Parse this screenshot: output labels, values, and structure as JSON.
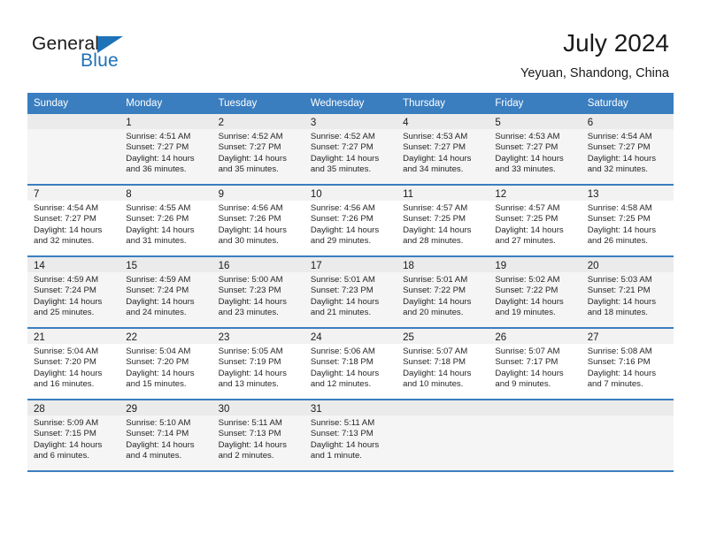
{
  "brand": {
    "name_part1": "General",
    "name_part2": "Blue",
    "accent_color": "#1d72b8"
  },
  "header": {
    "title": "July 2024",
    "subtitle": "Yeyuan, Shandong, China"
  },
  "theme": {
    "header_row_bg": "#3a7ec0",
    "daynum_bg": "#f2f2f2",
    "alt_row_bg": "#f5f5f5"
  },
  "weekday_headers": [
    "Sunday",
    "Monday",
    "Tuesday",
    "Wednesday",
    "Thursday",
    "Friday",
    "Saturday"
  ],
  "weeks": [
    [
      {
        "day": "",
        "sunrise": "",
        "sunset": "",
        "daylight_line1": "",
        "daylight_line2": ""
      },
      {
        "day": "1",
        "sunrise": "Sunrise: 4:51 AM",
        "sunset": "Sunset: 7:27 PM",
        "daylight_line1": "Daylight: 14 hours",
        "daylight_line2": "and 36 minutes."
      },
      {
        "day": "2",
        "sunrise": "Sunrise: 4:52 AM",
        "sunset": "Sunset: 7:27 PM",
        "daylight_line1": "Daylight: 14 hours",
        "daylight_line2": "and 35 minutes."
      },
      {
        "day": "3",
        "sunrise": "Sunrise: 4:52 AM",
        "sunset": "Sunset: 7:27 PM",
        "daylight_line1": "Daylight: 14 hours",
        "daylight_line2": "and 35 minutes."
      },
      {
        "day": "4",
        "sunrise": "Sunrise: 4:53 AM",
        "sunset": "Sunset: 7:27 PM",
        "daylight_line1": "Daylight: 14 hours",
        "daylight_line2": "and 34 minutes."
      },
      {
        "day": "5",
        "sunrise": "Sunrise: 4:53 AM",
        "sunset": "Sunset: 7:27 PM",
        "daylight_line1": "Daylight: 14 hours",
        "daylight_line2": "and 33 minutes."
      },
      {
        "day": "6",
        "sunrise": "Sunrise: 4:54 AM",
        "sunset": "Sunset: 7:27 PM",
        "daylight_line1": "Daylight: 14 hours",
        "daylight_line2": "and 32 minutes."
      }
    ],
    [
      {
        "day": "7",
        "sunrise": "Sunrise: 4:54 AM",
        "sunset": "Sunset: 7:27 PM",
        "daylight_line1": "Daylight: 14 hours",
        "daylight_line2": "and 32 minutes."
      },
      {
        "day": "8",
        "sunrise": "Sunrise: 4:55 AM",
        "sunset": "Sunset: 7:26 PM",
        "daylight_line1": "Daylight: 14 hours",
        "daylight_line2": "and 31 minutes."
      },
      {
        "day": "9",
        "sunrise": "Sunrise: 4:56 AM",
        "sunset": "Sunset: 7:26 PM",
        "daylight_line1": "Daylight: 14 hours",
        "daylight_line2": "and 30 minutes."
      },
      {
        "day": "10",
        "sunrise": "Sunrise: 4:56 AM",
        "sunset": "Sunset: 7:26 PM",
        "daylight_line1": "Daylight: 14 hours",
        "daylight_line2": "and 29 minutes."
      },
      {
        "day": "11",
        "sunrise": "Sunrise: 4:57 AM",
        "sunset": "Sunset: 7:25 PM",
        "daylight_line1": "Daylight: 14 hours",
        "daylight_line2": "and 28 minutes."
      },
      {
        "day": "12",
        "sunrise": "Sunrise: 4:57 AM",
        "sunset": "Sunset: 7:25 PM",
        "daylight_line1": "Daylight: 14 hours",
        "daylight_line2": "and 27 minutes."
      },
      {
        "day": "13",
        "sunrise": "Sunrise: 4:58 AM",
        "sunset": "Sunset: 7:25 PM",
        "daylight_line1": "Daylight: 14 hours",
        "daylight_line2": "and 26 minutes."
      }
    ],
    [
      {
        "day": "14",
        "sunrise": "Sunrise: 4:59 AM",
        "sunset": "Sunset: 7:24 PM",
        "daylight_line1": "Daylight: 14 hours",
        "daylight_line2": "and 25 minutes."
      },
      {
        "day": "15",
        "sunrise": "Sunrise: 4:59 AM",
        "sunset": "Sunset: 7:24 PM",
        "daylight_line1": "Daylight: 14 hours",
        "daylight_line2": "and 24 minutes."
      },
      {
        "day": "16",
        "sunrise": "Sunrise: 5:00 AM",
        "sunset": "Sunset: 7:23 PM",
        "daylight_line1": "Daylight: 14 hours",
        "daylight_line2": "and 23 minutes."
      },
      {
        "day": "17",
        "sunrise": "Sunrise: 5:01 AM",
        "sunset": "Sunset: 7:23 PM",
        "daylight_line1": "Daylight: 14 hours",
        "daylight_line2": "and 21 minutes."
      },
      {
        "day": "18",
        "sunrise": "Sunrise: 5:01 AM",
        "sunset": "Sunset: 7:22 PM",
        "daylight_line1": "Daylight: 14 hours",
        "daylight_line2": "and 20 minutes."
      },
      {
        "day": "19",
        "sunrise": "Sunrise: 5:02 AM",
        "sunset": "Sunset: 7:22 PM",
        "daylight_line1": "Daylight: 14 hours",
        "daylight_line2": "and 19 minutes."
      },
      {
        "day": "20",
        "sunrise": "Sunrise: 5:03 AM",
        "sunset": "Sunset: 7:21 PM",
        "daylight_line1": "Daylight: 14 hours",
        "daylight_line2": "and 18 minutes."
      }
    ],
    [
      {
        "day": "21",
        "sunrise": "Sunrise: 5:04 AM",
        "sunset": "Sunset: 7:20 PM",
        "daylight_line1": "Daylight: 14 hours",
        "daylight_line2": "and 16 minutes."
      },
      {
        "day": "22",
        "sunrise": "Sunrise: 5:04 AM",
        "sunset": "Sunset: 7:20 PM",
        "daylight_line1": "Daylight: 14 hours",
        "daylight_line2": "and 15 minutes."
      },
      {
        "day": "23",
        "sunrise": "Sunrise: 5:05 AM",
        "sunset": "Sunset: 7:19 PM",
        "daylight_line1": "Daylight: 14 hours",
        "daylight_line2": "and 13 minutes."
      },
      {
        "day": "24",
        "sunrise": "Sunrise: 5:06 AM",
        "sunset": "Sunset: 7:18 PM",
        "daylight_line1": "Daylight: 14 hours",
        "daylight_line2": "and 12 minutes."
      },
      {
        "day": "25",
        "sunrise": "Sunrise: 5:07 AM",
        "sunset": "Sunset: 7:18 PM",
        "daylight_line1": "Daylight: 14 hours",
        "daylight_line2": "and 10 minutes."
      },
      {
        "day": "26",
        "sunrise": "Sunrise: 5:07 AM",
        "sunset": "Sunset: 7:17 PM",
        "daylight_line1": "Daylight: 14 hours",
        "daylight_line2": "and 9 minutes."
      },
      {
        "day": "27",
        "sunrise": "Sunrise: 5:08 AM",
        "sunset": "Sunset: 7:16 PM",
        "daylight_line1": "Daylight: 14 hours",
        "daylight_line2": "and 7 minutes."
      }
    ],
    [
      {
        "day": "28",
        "sunrise": "Sunrise: 5:09 AM",
        "sunset": "Sunset: 7:15 PM",
        "daylight_line1": "Daylight: 14 hours",
        "daylight_line2": "and 6 minutes."
      },
      {
        "day": "29",
        "sunrise": "Sunrise: 5:10 AM",
        "sunset": "Sunset: 7:14 PM",
        "daylight_line1": "Daylight: 14 hours",
        "daylight_line2": "and 4 minutes."
      },
      {
        "day": "30",
        "sunrise": "Sunrise: 5:11 AM",
        "sunset": "Sunset: 7:13 PM",
        "daylight_line1": "Daylight: 14 hours",
        "daylight_line2": "and 2 minutes."
      },
      {
        "day": "31",
        "sunrise": "Sunrise: 5:11 AM",
        "sunset": "Sunset: 7:13 PM",
        "daylight_line1": "Daylight: 14 hours",
        "daylight_line2": "and 1 minute."
      },
      {
        "day": "",
        "sunrise": "",
        "sunset": "",
        "daylight_line1": "",
        "daylight_line2": ""
      },
      {
        "day": "",
        "sunrise": "",
        "sunset": "",
        "daylight_line1": "",
        "daylight_line2": ""
      },
      {
        "day": "",
        "sunrise": "",
        "sunset": "",
        "daylight_line1": "",
        "daylight_line2": ""
      }
    ]
  ]
}
